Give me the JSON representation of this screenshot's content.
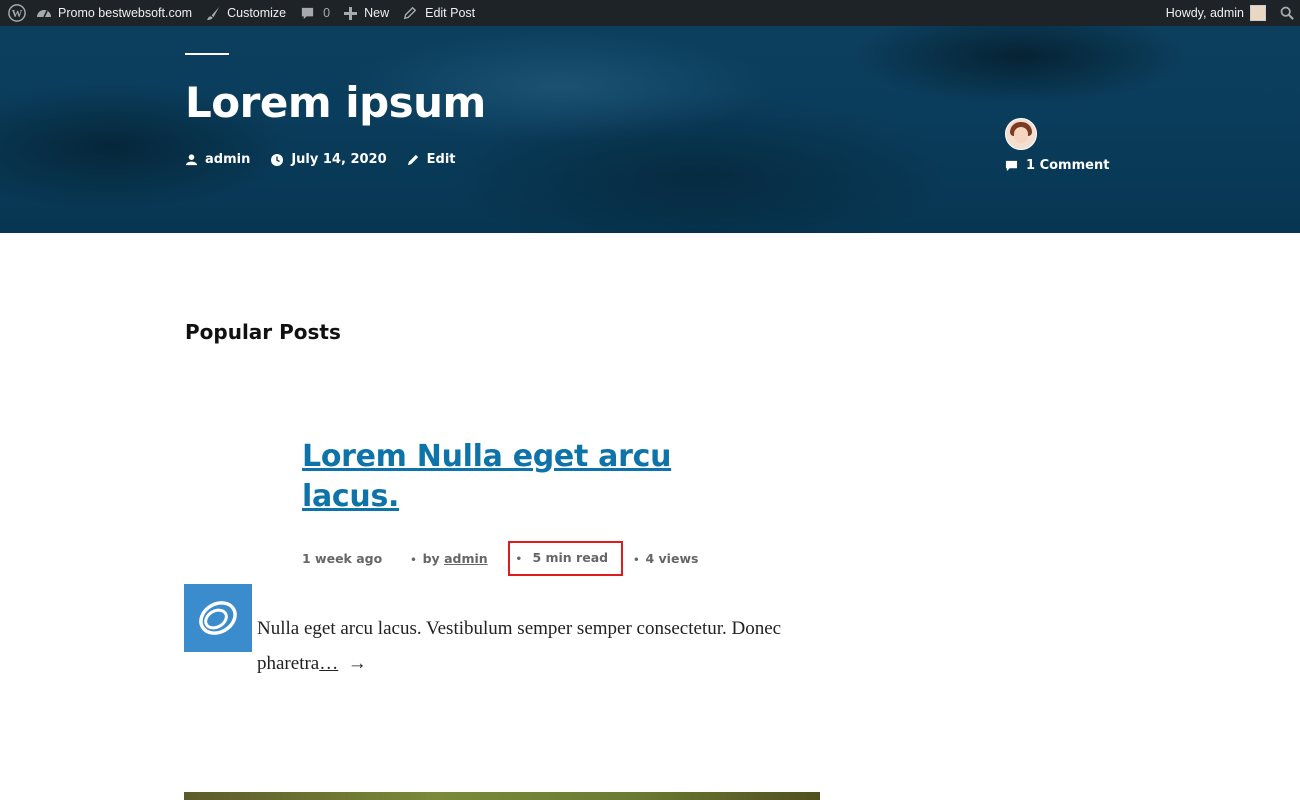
{
  "admin_bar": {
    "site_name": "Promo bestwebsoft.com",
    "customize": "Customize",
    "comments_count": "0",
    "new": "New",
    "edit_post": "Edit Post",
    "howdy": "Howdy, admin"
  },
  "hero": {
    "title": "Lorem ipsum",
    "author": "admin",
    "date": "July 14, 2020",
    "edit": "Edit",
    "comments": "1 Comment"
  },
  "popular_posts": {
    "heading": "Popular Posts",
    "post": {
      "title": "Lorem Nulla eget arcu lacus.",
      "time_ago": "1 week ago",
      "by_prefix": "by",
      "author": "admin",
      "read_time": "5 min read",
      "views": "4 views",
      "excerpt": "Nulla eget arcu lacus. Vestibulum semper semper consectetur. Donec pharetra",
      "more": "…",
      "arrow": "→"
    }
  }
}
